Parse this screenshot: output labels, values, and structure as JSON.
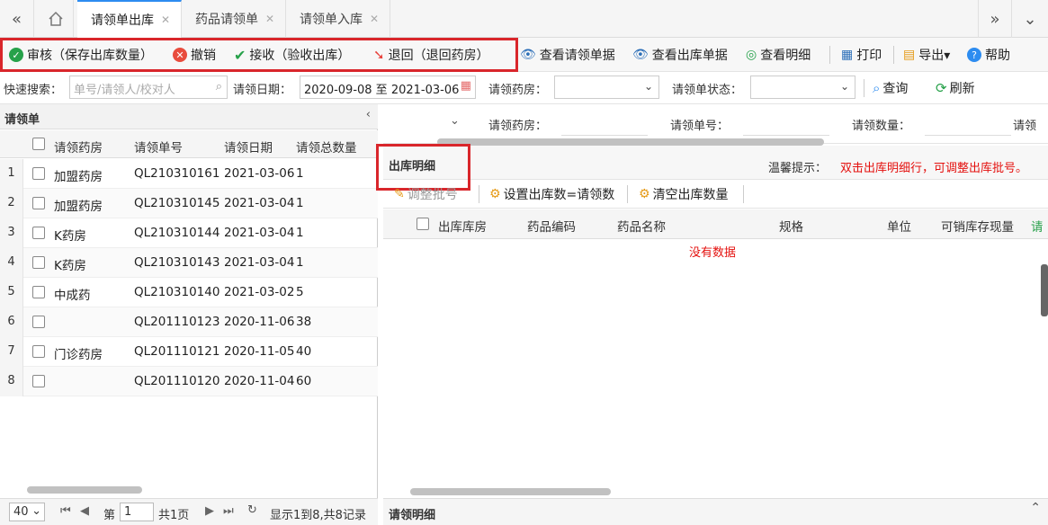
{
  "tabs": [
    {
      "label": "请领单出库",
      "active": true
    },
    {
      "label": "药品请领单",
      "active": false
    },
    {
      "label": "请领单入库",
      "active": false
    }
  ],
  "toolbar": {
    "audit": "审核（保存出库数量）",
    "revoke": "撤销",
    "receive": "接收（验收出库）",
    "return": "退回（退回药房）",
    "view_request": "查看请领单据",
    "view_outbound": "查看出库单据",
    "view_detail": "查看明细",
    "print": "打印",
    "export": "导出▾",
    "help": "帮助"
  },
  "search": {
    "quick_label": "快速搜索：",
    "quick_placeholder": "单号/请领人/校对人",
    "date_label": "请领日期：",
    "date_value": "2020-09-08 至 2021-03-06",
    "pharmacy_label": "请领药房：",
    "status_label": "请领单状态：",
    "query": "查询",
    "refresh": "刷新"
  },
  "left_panel": {
    "title": "请领单",
    "columns": [
      "请领药房",
      "请领单号",
      "请领日期",
      "请领总数量"
    ],
    "rows": [
      {
        "n": "1",
        "pharmacy": "加盟药房",
        "no": "QL210310161",
        "date": "2021-03-06",
        "qty": "1"
      },
      {
        "n": "2",
        "pharmacy": "加盟药房",
        "no": "QL210310145",
        "date": "2021-03-04",
        "qty": "1"
      },
      {
        "n": "3",
        "pharmacy": "K药房",
        "no": "QL210310144",
        "date": "2021-03-04",
        "qty": "1"
      },
      {
        "n": "4",
        "pharmacy": "K药房",
        "no": "QL210310143",
        "date": "2021-03-04",
        "qty": "1"
      },
      {
        "n": "5",
        "pharmacy": "中成药",
        "no": "QL210310140",
        "date": "2021-03-02",
        "qty": "5"
      },
      {
        "n": "6",
        "pharmacy": "",
        "no": "QL201110123",
        "date": "2020-11-06",
        "qty": "38"
      },
      {
        "n": "7",
        "pharmacy": "门诊药房",
        "no": "QL201110121",
        "date": "2020-11-05",
        "qty": "40"
      },
      {
        "n": "8",
        "pharmacy": "",
        "no": "QL201110120",
        "date": "2020-11-04",
        "qty": "60"
      }
    ]
  },
  "right_panel": {
    "form_labels": [
      "请领药房：",
      "请领单号：",
      "请领数量：",
      "请领"
    ],
    "section_title": "出库明细",
    "hint_label": "温馨提示：",
    "hint_text": "双击出库明细行，可调整出库批号。",
    "adjust_batch": "调整批号",
    "set_qty": "设置出库数=请领数",
    "clear_qty": "清空出库数量",
    "columns": [
      "出库库房",
      "药品编码",
      "药品名称",
      "规格",
      "单位",
      "可销库存现量",
      "请"
    ],
    "empty": "没有数据",
    "footer_title": "请领明细"
  },
  "pager": {
    "size": "40",
    "page_label": "第",
    "page_value": "1",
    "total_pages": "共1页",
    "summary": "显示1到8,共8记录"
  },
  "colors": {
    "red_box": "#d9262b",
    "hint_red": "#e4100e",
    "accent_blue": "#2d8cf0"
  }
}
